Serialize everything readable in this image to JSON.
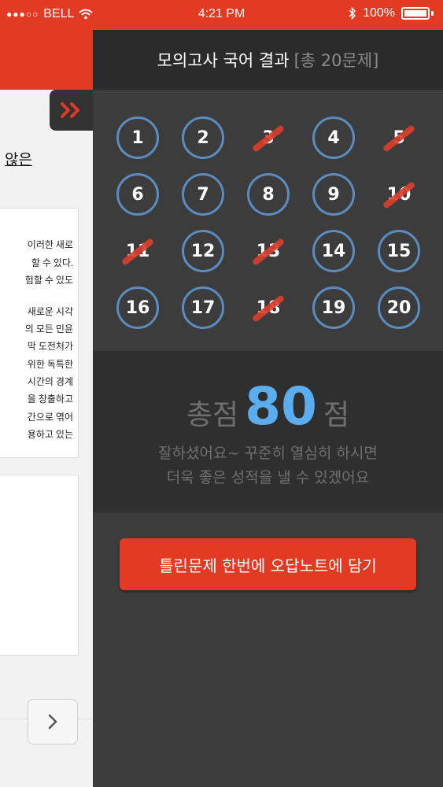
{
  "status_bar": {
    "signal_dots": "●●●○○",
    "carrier": "BELL",
    "time": "4:21 PM",
    "battery": "100%",
    "icons": [
      "wifi-icon",
      "bluetooth-icon",
      "battery-icon"
    ]
  },
  "left_page": {
    "heading_fragment": "않은",
    "passage_lines": [
      "이러한 새로",
      "할 수 있다.",
      "험할 수 있도",
      "새로운 시각",
      "의 모든 민윤",
      "막 도전처가",
      "위한 독특한",
      "시간의 경계",
      "을 창출하고",
      "간으로 엮어",
      "용하고 있는"
    ],
    "next_icon": "chevron-right-icon"
  },
  "panel": {
    "title": "모의고사 국어 결과",
    "count_label": "[총 20문제]",
    "toggle_icon": "double-chevron-right-icon",
    "questions": [
      {
        "n": "1",
        "wrong": false
      },
      {
        "n": "2",
        "wrong": false
      },
      {
        "n": "3",
        "wrong": true
      },
      {
        "n": "4",
        "wrong": false
      },
      {
        "n": "5",
        "wrong": true
      },
      {
        "n": "6",
        "wrong": false
      },
      {
        "n": "7",
        "wrong": false
      },
      {
        "n": "8",
        "wrong": false
      },
      {
        "n": "9",
        "wrong": false
      },
      {
        "n": "10",
        "wrong": true
      },
      {
        "n": "11",
        "wrong": true
      },
      {
        "n": "12",
        "wrong": false
      },
      {
        "n": "13",
        "wrong": true
      },
      {
        "n": "14",
        "wrong": false
      },
      {
        "n": "15",
        "wrong": false
      },
      {
        "n": "16",
        "wrong": false
      },
      {
        "n": "17",
        "wrong": false
      },
      {
        "n": "18",
        "wrong": true
      },
      {
        "n": "19",
        "wrong": false
      },
      {
        "n": "20",
        "wrong": false
      }
    ],
    "score": {
      "prefix": "총점",
      "value": "80",
      "suffix": "점",
      "message_line1": "잘하셨어요~ 꾸준히 열심히 하시면",
      "message_line2": "더욱 좋은 성적을 낼 수 있겠어요"
    },
    "cta_label": "틀린문제 한번에 오답노트에 담기"
  },
  "colors": {
    "brand_red": "#e23a23",
    "panel_dark": "#3c3c3c",
    "circle_blue": "#5b8cc0",
    "score_blue": "#5aaef0",
    "wrong_mark": "#d93e2b"
  }
}
